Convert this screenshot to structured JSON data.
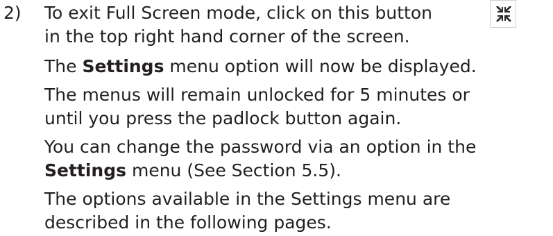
{
  "step": {
    "number": "2)"
  },
  "paragraphs": {
    "p1": {
      "line1": "To exit Full Screen mode, click on this button",
      "line2": "in the top right hand corner of the screen."
    },
    "p2": {
      "pre": "The ",
      "bold": "Settings",
      "post": " menu option will now be displayed."
    },
    "p3": {
      "line1": "The menus will remain unlocked for 5 minutes or",
      "line2": "until you press the padlock button again."
    },
    "p4": {
      "line1": "You can change the password via an option in the",
      "bold": "Settings",
      "post": " menu (See Section 5.5)."
    },
    "p5": {
      "line1": "The options available in the Settings menu are",
      "line2": "described in the following pages."
    }
  },
  "icons": {
    "exit_fullscreen": "exit-fullscreen-icon"
  },
  "colors": {
    "text": "#231f20",
    "icon": "#2b2b2b"
  }
}
